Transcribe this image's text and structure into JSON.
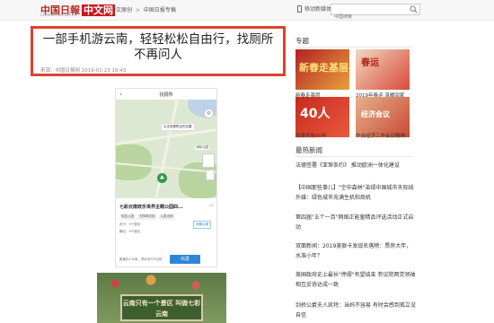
{
  "header": {
    "logo_text": "中国日報",
    "logo_box": "中文网",
    "logo_url": "CHINADAILY.COM.CN",
    "breadcrumb": [
      "中文原创",
      "中国日报专稿"
    ],
    "breadcrumb_sep": ">",
    "mobile_label": "移动新媒体",
    "search_placeholder": "中国搜索"
  },
  "article": {
    "title": "一部手机游云南，轻轻松松自由行，找厕所不再问人",
    "meta": "来源：中国日报网 2019-01-23 18:43"
  },
  "phone_screen": {
    "top_title": "找厕所",
    "map_tip": "点击查看附近的位置",
    "map_label": "洲际公园",
    "place_name": "七彩云南欢乐世界主题公园四...",
    "place_page": "1/2",
    "tags": [
      "免费入园",
      "无障碍设施",
      "儿童设施"
    ],
    "row1": "步行：9个座位",
    "row2": "蹲位：9个座位",
    "row_button": "我要纠错",
    "nav_note": "距离约130米，预计步行3分钟",
    "nav_button": "出发",
    "pin_glyph": "♣"
  },
  "photo": {
    "sign_text": "云南只有一个景区 叫做七彩云南"
  },
  "sidebar": {
    "topics_heading": "专题",
    "topics": [
      {
        "caption": "新春走基层",
        "thumb_text": "新春走基层"
      },
      {
        "caption": "2019年春运 温暖回家",
        "thumb_text": "春运"
      },
      {
        "caption": "改革开放40年",
        "thumb_text": "40人"
      },
      {
        "caption": "中央经济工作会议精神",
        "thumb_text": "经济会议"
      }
    ],
    "latest_heading": "最热新闻",
    "news": [
      "法德签署《亚琛条约》 推动欧洲一体化建设",
      "【中国那些事儿】\"空中森林\"染绿中国城市天际线 外媒：绿色城市充满生机和商机",
      "第四届\"五个一百\"网络正能量精品评选活动正式启动",
      "双面新闻：2019美联卡发现名落榜：票房大年，水准小年？",
      "美国政府史上最长\"停摆\"有望结束 参议院两党领袖相互妥协达成一致",
      "剑桥公爵夫人凯特：当妈不容易 有时会感到孤立没自信"
    ]
  }
}
